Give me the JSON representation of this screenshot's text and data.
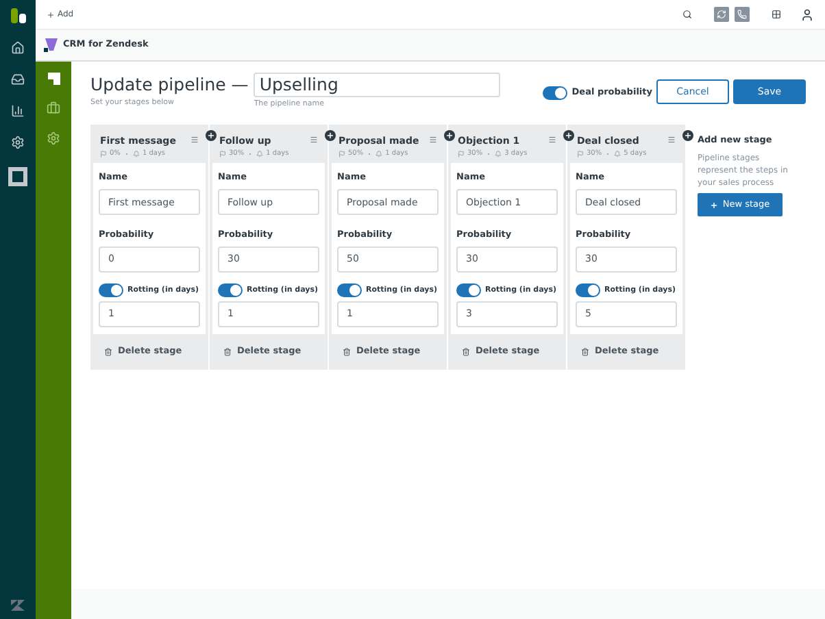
{
  "top_bar": {
    "add_label": "Add"
  },
  "app_header": {
    "title": "CRM for Zendesk"
  },
  "page": {
    "title": "Update pipeline —",
    "subtitle": "Set your stages below",
    "pipeline_name": {
      "value": "Upselling",
      "hint": "The pipeline name"
    },
    "deal_probability": {
      "label": "Deal probability",
      "on": true
    },
    "buttons": {
      "cancel": "Cancel",
      "save": "Save"
    }
  },
  "stages": [
    {
      "name": "First message",
      "meta_probability": "0%",
      "meta_rotting": "1 days",
      "name_label": "Name",
      "name_value": "First message",
      "probability_label": "Probability",
      "probability_value": "0",
      "rotting_label": "Rotting (in days)",
      "rotting_on": true,
      "rotting_value": "1",
      "delete_label": "Delete stage"
    },
    {
      "name": "Follow up",
      "meta_probability": "30%",
      "meta_rotting": "1 days",
      "name_label": "Name",
      "name_value": "Follow up",
      "probability_label": "Probability",
      "probability_value": "30",
      "rotting_label": "Rotting (in days)",
      "rotting_on": true,
      "rotting_value": "1",
      "delete_label": "Delete stage"
    },
    {
      "name": "Proposal made",
      "meta_probability": "50%",
      "meta_rotting": "1 days",
      "name_label": "Name",
      "name_value": "Proposal made",
      "probability_label": "Probability",
      "probability_value": "50",
      "rotting_label": "Rotting (in days)",
      "rotting_on": true,
      "rotting_value": "1",
      "delete_label": "Delete stage"
    },
    {
      "name": "Objection 1",
      "meta_probability": "30%",
      "meta_rotting": "3 days",
      "name_label": "Name",
      "name_value": "Objection 1",
      "probability_label": "Probability",
      "probability_value": "30",
      "rotting_label": "Rotting (in days)",
      "rotting_on": true,
      "rotting_value": "3",
      "delete_label": "Delete stage"
    },
    {
      "name": "Deal closed",
      "meta_probability": "30%",
      "meta_rotting": "5 days",
      "name_label": "Name",
      "name_value": "Deal closed",
      "probability_label": "Probability",
      "probability_value": "30",
      "rotting_label": "Rotting (in days)",
      "rotting_on": true,
      "rotting_value": "5",
      "delete_label": "Delete stage"
    }
  ],
  "add_stage": {
    "title": "Add new stage",
    "description": "Pipeline stages represent the steps in your sales process",
    "button": "New stage"
  }
}
